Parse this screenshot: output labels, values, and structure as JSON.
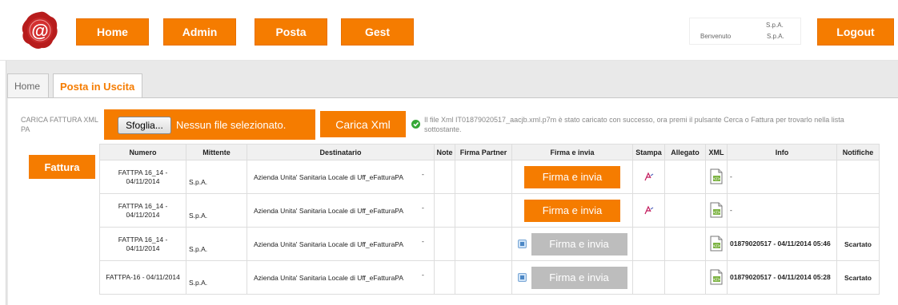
{
  "nav": {
    "home": "Home",
    "admin": "Admin",
    "posta": "Posta",
    "gest": "Gest",
    "logout": "Logout"
  },
  "user": {
    "company": "S.p.A.",
    "welcome": "Benvenuto",
    "company2": "S.p.A."
  },
  "tabs": {
    "home": "Home",
    "posta_uscita": "Posta in Uscita"
  },
  "upload": {
    "label": "CARICA FATTURA XML PA",
    "browse": "Sfoglia...",
    "no_file": "Nessun file selezionato.",
    "carica": "Carica Xml",
    "success": "Il file Xml IT01879020517_aacjb.xml.p7m è stato caricato con successo, ora premi il pulsante Cerca o Fattura per trovarlo nella lista sottostante."
  },
  "fattura_button": "Fattura",
  "table": {
    "headers": [
      "Numero",
      "Mittente",
      "Destinatario",
      "Note",
      "Firma Partner",
      "Firma e invia",
      "Stampa",
      "Allegato",
      "XML",
      "Info",
      "Notifiche"
    ],
    "rows": [
      {
        "numero": "FATTPA 16_14 - 04/11/2014",
        "mittente": "S.p.A.",
        "destinatario": "Azienda Unita' Sanitaria Locale   di Uff_eFatturaPA",
        "dash": "-",
        "firma": "Firma e invia",
        "info": "-",
        "notifiche": ""
      },
      {
        "numero": "FATTPA 16_14 - 04/11/2014",
        "mittente": "S.p.A.",
        "destinatario": "Azienda Unita' Sanitaria Locale   di Uff_eFatturaPA",
        "dash": "-",
        "firma": "Firma e invia",
        "info": "-",
        "notifiche": ""
      },
      {
        "numero": "FATTPA 16_14 - 04/11/2014",
        "mittente": "S.p.A.",
        "destinatario": "Azienda Unita' Sanitaria Locale   di Uff_eFatturaPA",
        "dash": "-",
        "firma": "Firma e invia",
        "info": "01879020517 - 04/11/2014 05:46",
        "notifiche": "Scartato"
      },
      {
        "numero": "FATTPA-16 - 04/11/2014",
        "mittente": "S.p.A.",
        "destinatario": "Azienda Unita' Sanitaria Locale   di Uff_eFatturaPA",
        "dash": "-",
        "firma": "Firma e invia",
        "info": "01879020517 - 04/11/2014 05:28",
        "notifiche": "Scartato"
      }
    ]
  },
  "colors": {
    "accent": "#f57c00",
    "disabled": "#bdbdbd",
    "success": "#35a836"
  }
}
